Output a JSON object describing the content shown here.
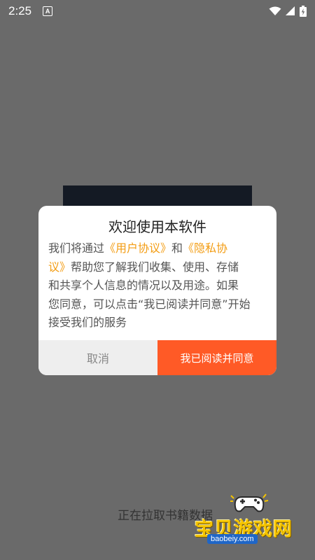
{
  "status_bar": {
    "time": "2:25",
    "notification_letter": "A",
    "icons": [
      "wifi-icon",
      "signal-icon",
      "battery-charging-icon"
    ]
  },
  "dialog": {
    "title": "欢迎使用本软件",
    "body_lines": [
      [
        "我们将通过",
        "《用户协议》",
        "和",
        "《隐私协"
      ],
      [
        "议》",
        "帮助您了解我们收集、使用、存储"
      ],
      [
        "和共享个人信息的情况以及用途。如果"
      ],
      [
        "您同意，可以点击“我已阅读并同意”开始"
      ],
      [
        "接受我们的服务"
      ]
    ],
    "text": {
      "p1": "我们将通过",
      "link_user": "《用户协议》",
      "p2": "和",
      "link_privacy_a": "《隐私协",
      "link_privacy_b": "议》",
      "p3": "帮助您了解我们收集、使用、存储",
      "p4": "和共享个人信息的情况以及用途。如果",
      "p5": "您同意，可以点击“我已阅读并同意”开始",
      "p6": "接受我们的服务"
    },
    "cancel_label": "取消",
    "agree_label": "我已阅读并同意"
  },
  "loading_text": "正在拉取书籍数据",
  "watermark": {
    "title": "宝贝游戏网",
    "url": "baobeiy.com"
  },
  "colors": {
    "overlay": "#6a6a6a",
    "link": "#f39c12",
    "accent": "#ff5a26",
    "cancel_bg": "#eeeeee"
  }
}
